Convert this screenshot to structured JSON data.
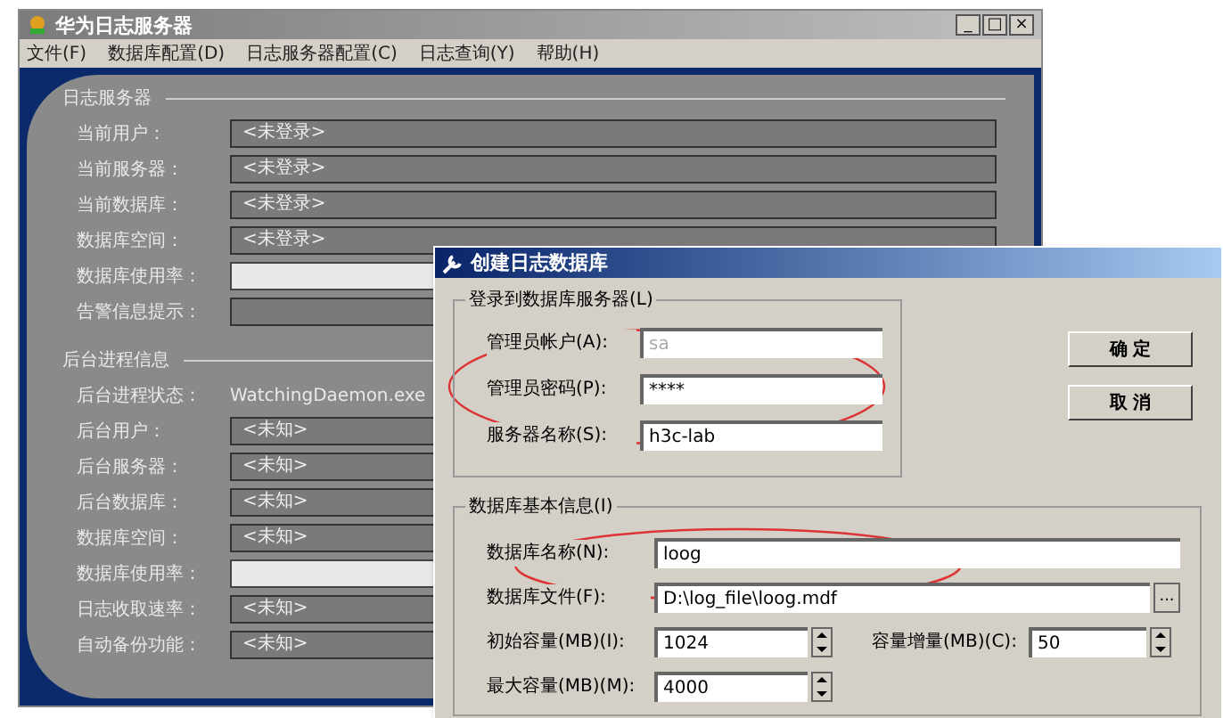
{
  "window": {
    "title": "华为日志服务器",
    "controls": [
      "_",
      "□",
      "×"
    ]
  },
  "menu": [
    {
      "label": "文件(F)"
    },
    {
      "label": "数据库配置(D)"
    },
    {
      "label": "日志服务器配置(C)"
    },
    {
      "label": "日志查询(Y)"
    },
    {
      "label": "帮助(H)"
    }
  ],
  "log_server": {
    "heading": "日志服务器",
    "rows": [
      {
        "label": "当前用户：",
        "kind": "text",
        "value": "<未登录>"
      },
      {
        "label": "当前服务器：",
        "kind": "text",
        "value": "<未登录>"
      },
      {
        "label": "当前数据库：",
        "kind": "text",
        "value": "<未登录>"
      },
      {
        "label": "数据库空间：",
        "kind": "text",
        "value": "<未登录>"
      },
      {
        "label": "数据库使用率：",
        "kind": "blank"
      },
      {
        "label": "告警信息提示：",
        "kind": "text"
      }
    ]
  },
  "daemon": {
    "heading": "后台进程信息",
    "status_label": "后台进程状态：",
    "status_value": "WatchingDaemon.exe",
    "rows": [
      {
        "label": "后台用户：",
        "kind": "text",
        "value": "<未知>"
      },
      {
        "label": "后台服务器：",
        "kind": "text",
        "value": "<未知>"
      },
      {
        "label": "后台数据库：",
        "kind": "text",
        "value": "<未知>"
      },
      {
        "label": "数据库空间：",
        "kind": "text",
        "value": "<未知>"
      },
      {
        "label": "数据库使用率：",
        "kind": "blank"
      },
      {
        "label": "日志收取速率：",
        "kind": "text",
        "value": "<未知>"
      },
      {
        "label": "自动备份功能：",
        "kind": "text",
        "value": "<未知>"
      }
    ]
  },
  "dialog": {
    "title": "创建日志数据库",
    "login_group": {
      "title": "登录到数据库服务器(L)",
      "fields": [
        {
          "label": "管理员帐户(A):",
          "value": "sa",
          "disabled": true
        },
        {
          "label": "管理员密码(P):",
          "value": "****",
          "disabled": false
        },
        {
          "label": "服务器名称(S):",
          "value": "h3c-lab",
          "disabled": false
        }
      ]
    },
    "buttons": [
      "确 定",
      "取 消"
    ],
    "db_group": {
      "title": "数据库基本信息(I)",
      "name": {
        "label": "数据库名称(N):",
        "value": "loog"
      },
      "file": {
        "label": "数据库文件(F):",
        "value": "D:\\log_file\\loog.mdf",
        "browse": "..."
      },
      "initial": {
        "label": "初始容量(MB)(I):",
        "value": "1024"
      },
      "growth": {
        "label": "容量增量(MB)(C):",
        "value": "50"
      },
      "max": {
        "label": "最大容量(MB)(M):",
        "value": "4000"
      }
    }
  }
}
